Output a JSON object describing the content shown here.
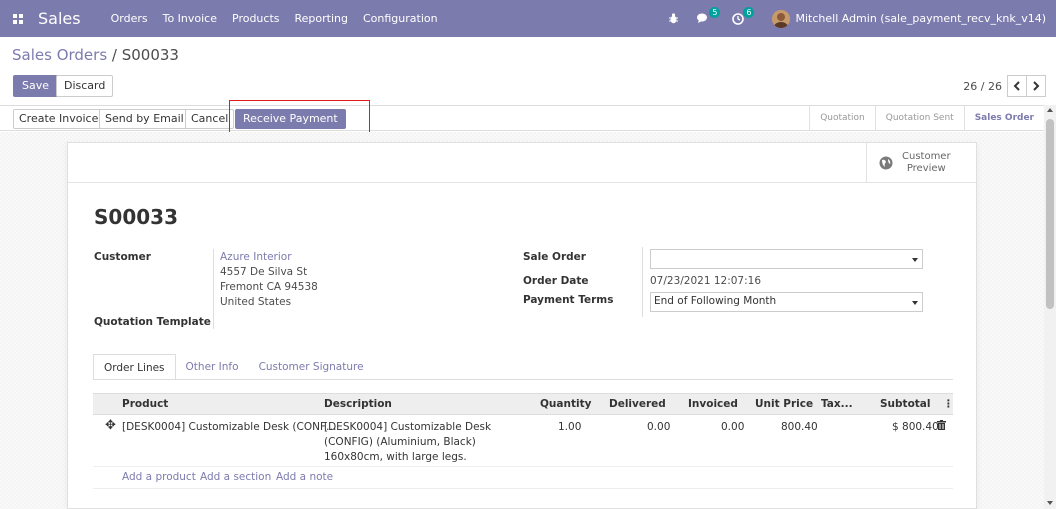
{
  "navbar": {
    "app_name": "Sales",
    "menu": [
      "Orders",
      "To Invoice",
      "Products",
      "Reporting",
      "Configuration"
    ],
    "messages_badge": "5",
    "activities_badge": "6",
    "user": "Mitchell Admin (sale_payment_recv_knk_v14)",
    "bg_color": "#7c7bad"
  },
  "breadcrumb": {
    "parent": "Sales Orders",
    "separator": " / ",
    "current": "S00033"
  },
  "toolbar": {
    "save": "Save",
    "discard": "Discard"
  },
  "pager": {
    "value": "26 / 26"
  },
  "statusbar": {
    "buttons": [
      "Create Invoice",
      "Send by Email",
      "Cancel"
    ],
    "receive_payment": "Receive Payment",
    "stages": [
      "Quotation",
      "Quotation Sent",
      "Sales Order"
    ],
    "active_stage": "Sales Order"
  },
  "sheet": {
    "customer_preview_line1": "Customer",
    "customer_preview_line2": "Preview",
    "name": "S00033",
    "customer_label": "Customer",
    "customer_name": "Azure Interior",
    "customer_addr1": "4557 De Silva St",
    "customer_addr2": "Fremont CA 94538",
    "customer_addr3": "United States",
    "quotation_template_label": "Quotation Template",
    "sale_order_label": "Sale Order",
    "sale_order_value": "",
    "order_date_label": "Order Date",
    "order_date_value": "07/23/2021 12:07:16",
    "payment_terms_label": "Payment Terms",
    "payment_terms_value": "End of Following Month"
  },
  "tabs": [
    "Order Lines",
    "Other Info",
    "Customer Signature"
  ],
  "table": {
    "headers": [
      "Product",
      "Description",
      "Quantity",
      "Delivered",
      "Invoiced",
      "Unit Price",
      "Tax...",
      "Subtotal"
    ],
    "rows": [
      {
        "product": "[DESK0004] Customizable Desk (CONF…",
        "desc1": "[DESK0004] Customizable Desk",
        "desc2": "(CONFIG) (Aluminium, Black)",
        "desc3": "160x80cm, with large legs.",
        "quantity": "1.00",
        "delivered": "0.00",
        "invoiced": "0.00",
        "unit_price": "800.40",
        "taxes": "",
        "subtotal": "$ 800.40"
      }
    ],
    "add_product": "Add a product",
    "add_section": "Add a section",
    "add_note": "Add a note"
  }
}
